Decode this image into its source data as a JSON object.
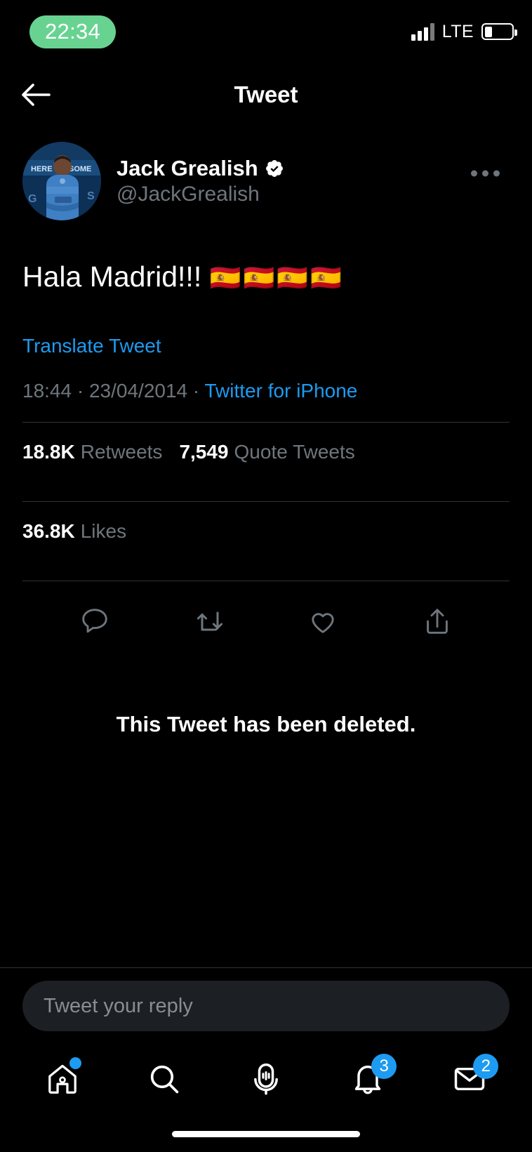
{
  "status_bar": {
    "time": "22:34",
    "time_pill_color": "#68d391",
    "network_label": "LTE",
    "signal_icon": "signal-bars-icon",
    "battery_icon": "battery-icon",
    "battery_level_percent": 28
  },
  "header": {
    "title": "Tweet",
    "back_icon": "back-arrow-icon"
  },
  "tweet": {
    "author_name": "Jack Grealish",
    "author_handle": "@JackGrealish",
    "verified": true,
    "verified_icon": "verified-badge-icon",
    "avatar_icon": "avatar-image",
    "more_icon": "more-options-icon",
    "text": "Hala Madrid!!!",
    "flags": "🇪🇸🇪🇸🇪🇸🇪🇸",
    "translate_label": "Translate Tweet",
    "time": "18:44",
    "separator": " · ",
    "date": "23/04/2014",
    "source": "Twitter for iPhone",
    "stats": [
      {
        "value": "18.8K",
        "label": "Retweets"
      },
      {
        "value": "7,549",
        "label": "Quote Tweets"
      }
    ],
    "likes": {
      "value": "36.8K",
      "label": "Likes"
    },
    "actions": [
      {
        "name": "reply-icon",
        "label": "Reply"
      },
      {
        "name": "retweet-icon",
        "label": "Retweet"
      },
      {
        "name": "like-icon",
        "label": "Like"
      },
      {
        "name": "share-icon",
        "label": "Share"
      }
    ],
    "deleted_notice": "This Tweet has been deleted."
  },
  "composer": {
    "placeholder": "Tweet your reply",
    "value": ""
  },
  "tab_bar": {
    "items": [
      {
        "name": "home-icon",
        "label": "Home",
        "badge": "",
        "dot": true
      },
      {
        "name": "search-icon",
        "label": "Search",
        "badge": "",
        "dot": false
      },
      {
        "name": "spaces-icon",
        "label": "Spaces",
        "badge": "",
        "dot": false
      },
      {
        "name": "notifications-icon",
        "label": "Notifications",
        "badge": "3",
        "dot": false
      },
      {
        "name": "messages-icon",
        "label": "Messages",
        "badge": "2",
        "dot": false
      }
    ]
  },
  "colors": {
    "background": "#000000",
    "accent": "#1d9bf0",
    "secondary_text": "#6e767d",
    "divider": "#2f3336",
    "composer_bg": "#1c1f23"
  },
  "home_indicator": {
    "icon": "home-indicator-bar"
  }
}
